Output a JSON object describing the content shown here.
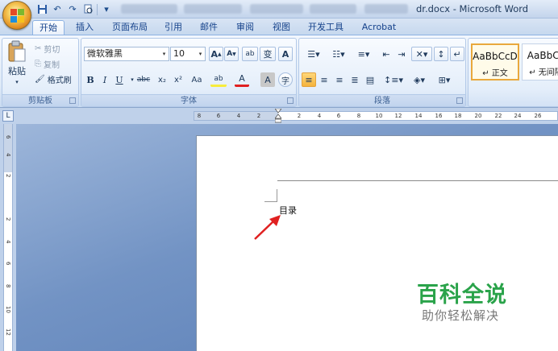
{
  "window": {
    "title": "dr.docx - Microsoft Word"
  },
  "quick_access": {
    "icons": [
      "save-icon",
      "undo-icon",
      "redo-icon",
      "print-preview-icon",
      "customize-icon"
    ]
  },
  "tabs": [
    {
      "label": "开始",
      "active": true
    },
    {
      "label": "插入"
    },
    {
      "label": "页面布局"
    },
    {
      "label": "引用"
    },
    {
      "label": "邮件"
    },
    {
      "label": "审阅"
    },
    {
      "label": "视图"
    },
    {
      "label": "开发工具"
    },
    {
      "label": "Acrobat"
    }
  ],
  "clipboard": {
    "paste": "粘贴",
    "cut": "剪切",
    "copy": "复制",
    "format_painter": "格式刷",
    "group_label": "剪贴板"
  },
  "font": {
    "font_name": "微软雅黑",
    "font_size": "10",
    "grow": "A",
    "shrink": "A",
    "clear": "ab",
    "phonetic": "变",
    "border_char": "A",
    "bold": "B",
    "italic": "I",
    "underline": "U",
    "strike": "abc",
    "subscript": "x₂",
    "superscript": "x²",
    "change_case": "Aa",
    "highlight": "ab",
    "font_color": "A",
    "shade_char": "A",
    "enclose_char": "字",
    "group_label": "字体"
  },
  "paragraph": {
    "group_label": "段落"
  },
  "styles": [
    {
      "sample": "AaBbCcD",
      "name": "↵ 正文",
      "selected": true
    },
    {
      "sample": "AaBbCc",
      "name": "↵ 无间隔"
    }
  ],
  "ruler": {
    "toggle": "L",
    "left_numbers": [
      "8",
      "6",
      "4",
      "2"
    ],
    "right_numbers": [
      "2",
      "4",
      "6",
      "8",
      "10",
      "12",
      "14",
      "16",
      "18",
      "20",
      "22",
      "24",
      "26"
    ],
    "vertical_numbers": [
      "6",
      "4",
      "2",
      "2",
      "4",
      "6",
      "8",
      "10",
      "12"
    ]
  },
  "document": {
    "text": "目录"
  },
  "watermark": {
    "title": "百科全说",
    "subtitle": "助你轻松解决"
  },
  "colors": {
    "arrow": "#e02020",
    "watermark_green": "#2aa34a",
    "accent": "#15428b"
  }
}
